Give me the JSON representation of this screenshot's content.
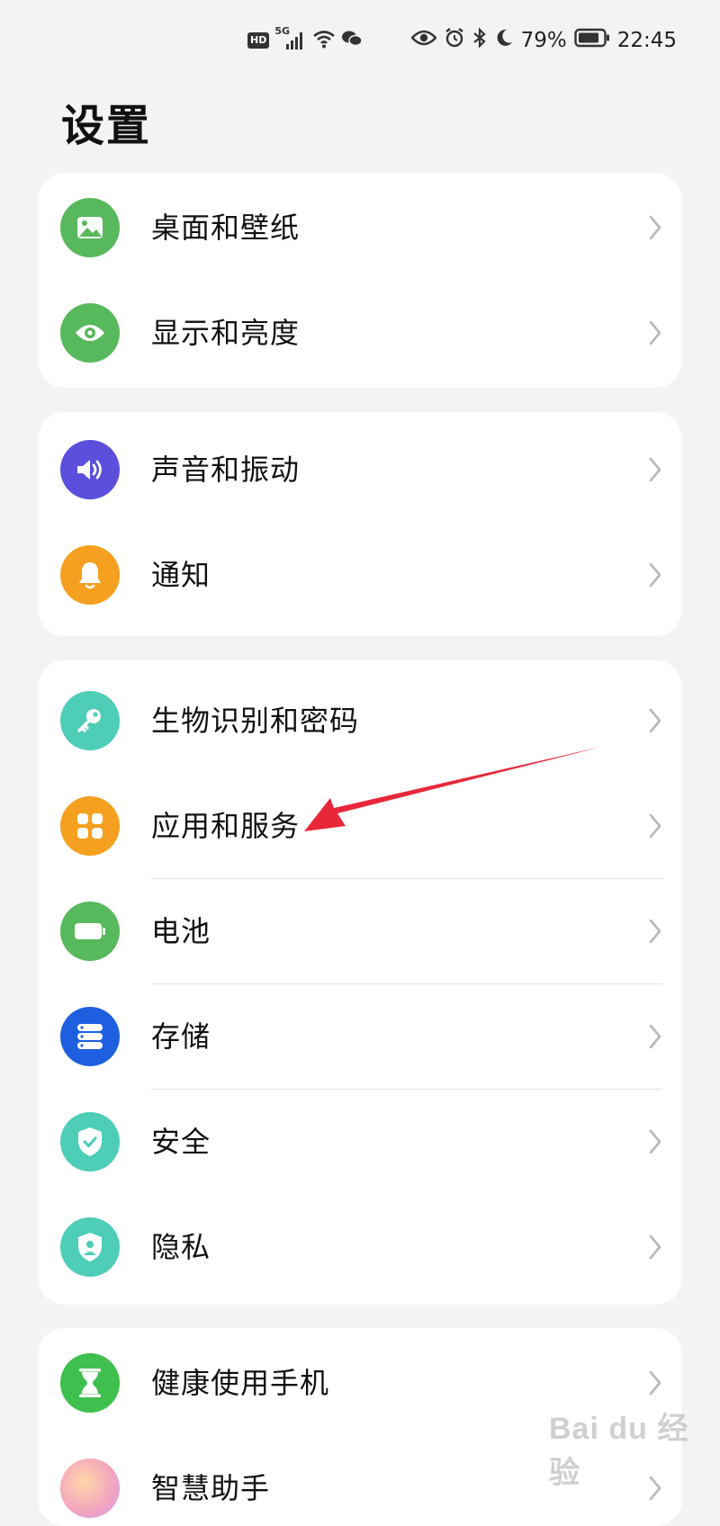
{
  "status_bar": {
    "hd": "HD",
    "network": "5G",
    "battery_percent": "79%",
    "time": "22:45"
  },
  "title": "设置",
  "groups": [
    {
      "items": [
        {
          "label": "桌面和壁纸",
          "icon": "wallpaper-icon",
          "color": "#58b85c"
        },
        {
          "label": "显示和亮度",
          "icon": "eye-icon",
          "color": "#58b85c"
        }
      ]
    },
    {
      "items": [
        {
          "label": "声音和振动",
          "icon": "speaker-icon",
          "color": "#5b4fdb"
        },
        {
          "label": "通知",
          "icon": "bell-icon",
          "color": "#f5a020"
        }
      ]
    },
    {
      "items": [
        {
          "label": "生物识别和密码",
          "icon": "key-icon",
          "color": "#4ecdb8"
        },
        {
          "label": "应用和服务",
          "icon": "apps-icon",
          "color": "#f5a020"
        },
        {
          "label": "电池",
          "icon": "battery-icon",
          "color": "#58b85c"
        },
        {
          "label": "存储",
          "icon": "storage-icon",
          "color": "#1e5fe0"
        },
        {
          "label": "安全",
          "icon": "shield-check-icon",
          "color": "#4ecdb8"
        },
        {
          "label": "隐私",
          "icon": "privacy-shield-icon",
          "color": "#4ecdb8"
        }
      ]
    },
    {
      "items": [
        {
          "label": "健康使用手机",
          "icon": "hourglass-icon",
          "color": "#3fbf4e"
        },
        {
          "label": "智慧助手",
          "icon": "assistant-icon",
          "color": "#f2a3c0"
        }
      ]
    }
  ],
  "annotation_arrow_color": "#e8283a",
  "watermark": "Bai du 经验"
}
